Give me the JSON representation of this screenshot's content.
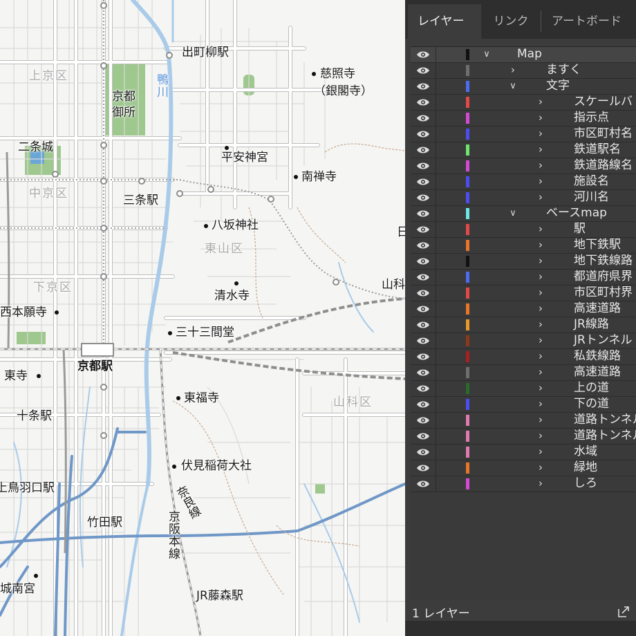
{
  "map": {
    "labels": [
      {
        "id": "demachiyanagi",
        "text": "出町柳駅"
      },
      {
        "id": "ginkakuji1",
        "text": "慈照寺"
      },
      {
        "id": "ginkakuji2",
        "text": "（銀閣寺）"
      },
      {
        "id": "kamigyo",
        "text": "上京区"
      },
      {
        "id": "kyotogosho1",
        "text": "京都"
      },
      {
        "id": "kyotogosho2",
        "text": "御所"
      },
      {
        "id": "kamogawa",
        "text": "鴨川"
      },
      {
        "id": "nijojo",
        "text": "二条城"
      },
      {
        "id": "heianjingu",
        "text": "平安神宮"
      },
      {
        "id": "nanzenji",
        "text": "南禅寺"
      },
      {
        "id": "nakagyo",
        "text": "中京区"
      },
      {
        "id": "sanjo",
        "text": "三条駅"
      },
      {
        "id": "yasaka",
        "text": "八坂神社"
      },
      {
        "id": "higashiyama",
        "text": "東山区"
      },
      {
        "id": "shimogyo",
        "text": "下京区"
      },
      {
        "id": "yamashina",
        "text": "山科"
      },
      {
        "id": "nishihonganji",
        "text": "西本願寺"
      },
      {
        "id": "kiyomizu",
        "text": "清水寺"
      },
      {
        "id": "sanjusangendo",
        "text": "三十三間堂"
      },
      {
        "id": "kyotoeki",
        "text": "京都駅"
      },
      {
        "id": "toji",
        "text": "東寺"
      },
      {
        "id": "tofukuji",
        "text": "東福寺"
      },
      {
        "id": "yamashinaku",
        "text": "山科区"
      },
      {
        "id": "jujo",
        "text": "十条駅"
      },
      {
        "id": "fushimiinari",
        "text": "伏見稲荷大社"
      },
      {
        "id": "kamitobaguchi",
        "text": "上鳥羽口駅"
      },
      {
        "id": "naraline",
        "text": "奈良線"
      },
      {
        "id": "takeda",
        "text": "竹田駅"
      },
      {
        "id": "keihan",
        "text": "京阪本線"
      },
      {
        "id": "jonangu",
        "text": "城南宮"
      },
      {
        "id": "jrfujinomori",
        "text": "JR藤森駅"
      },
      {
        "id": "edgeA",
        "text": "日"
      }
    ],
    "colors": {
      "background": "#f5f5f3",
      "road_major": "#ffffff",
      "road_casing": "#b9b9b9",
      "river": "#a9cbe9",
      "expressway": "#6f97c7",
      "park": "#9fc88f",
      "contour": "#c7a98f",
      "rail": "#9a9a9a"
    }
  },
  "panel": {
    "tabs": [
      "レイヤー",
      "リンク",
      "アートボード"
    ],
    "active_tab": "レイヤー",
    "layers": [
      {
        "name": "Map",
        "depth": 0,
        "expanded": true,
        "color": "#111111"
      },
      {
        "name": "ますく",
        "depth": 1,
        "expanded": false,
        "color": "#6e6e6e"
      },
      {
        "name": "文字",
        "depth": 1,
        "expanded": true,
        "color": "#4d6cf0"
      },
      {
        "name": "スケールバ",
        "depth": 2,
        "expanded": false,
        "color": "#e24a4a"
      },
      {
        "name": "指示点",
        "depth": 2,
        "expanded": false,
        "color": "#d44ad4"
      },
      {
        "name": "市区町村名",
        "depth": 2,
        "expanded": false,
        "color": "#4d4df0"
      },
      {
        "name": "鉄道駅名",
        "depth": 2,
        "expanded": false,
        "color": "#6ee66e"
      },
      {
        "name": "鉄道路線名",
        "depth": 2,
        "expanded": false,
        "color": "#d44ad4"
      },
      {
        "name": "施設名",
        "depth": 2,
        "expanded": false,
        "color": "#4d4df0"
      },
      {
        "name": "河川名",
        "depth": 2,
        "expanded": false,
        "color": "#4d4df0"
      },
      {
        "name": "ベースmap",
        "depth": 1,
        "expanded": true,
        "color": "#6ee6e6"
      },
      {
        "name": "駅",
        "depth": 2,
        "expanded": false,
        "color": "#e24a4a"
      },
      {
        "name": "地下鉄駅",
        "depth": 2,
        "expanded": false,
        "color": "#e8762a"
      },
      {
        "name": "地下鉄線路",
        "depth": 2,
        "expanded": false,
        "color": "#111111"
      },
      {
        "name": "都道府県界",
        "depth": 2,
        "expanded": false,
        "color": "#4d6cf0"
      },
      {
        "name": "市区町村界",
        "depth": 2,
        "expanded": false,
        "color": "#e24a4a"
      },
      {
        "name": "高速道路",
        "depth": 2,
        "expanded": false,
        "color": "#e8762a"
      },
      {
        "name": "JR線路",
        "depth": 2,
        "expanded": false,
        "color": "#e89a2a"
      },
      {
        "name": "JRトンネル",
        "depth": 2,
        "expanded": false,
        "color": "#8a3a1a"
      },
      {
        "name": "私鉄線路",
        "depth": 2,
        "expanded": false,
        "color": "#a82020"
      },
      {
        "name": "高速道路",
        "depth": 2,
        "expanded": false,
        "color": "#6e6e6e"
      },
      {
        "name": "上の道",
        "depth": 2,
        "expanded": false,
        "color": "#2a6a2a"
      },
      {
        "name": "下の道",
        "depth": 2,
        "expanded": false,
        "color": "#4d4df0"
      },
      {
        "name": "道路トンネル",
        "depth": 2,
        "expanded": false,
        "color": "#e07ab0"
      },
      {
        "name": "道路トンネル",
        "depth": 2,
        "expanded": false,
        "color": "#e07ab0"
      },
      {
        "name": "水域",
        "depth": 2,
        "expanded": false,
        "color": "#e07ab0"
      },
      {
        "name": "緑地",
        "depth": 2,
        "expanded": false,
        "color": "#e8762a"
      },
      {
        "name": "しろ",
        "depth": 2,
        "expanded": false,
        "color": "#d44ad4"
      }
    ],
    "footer_count": "1 レイヤー"
  }
}
